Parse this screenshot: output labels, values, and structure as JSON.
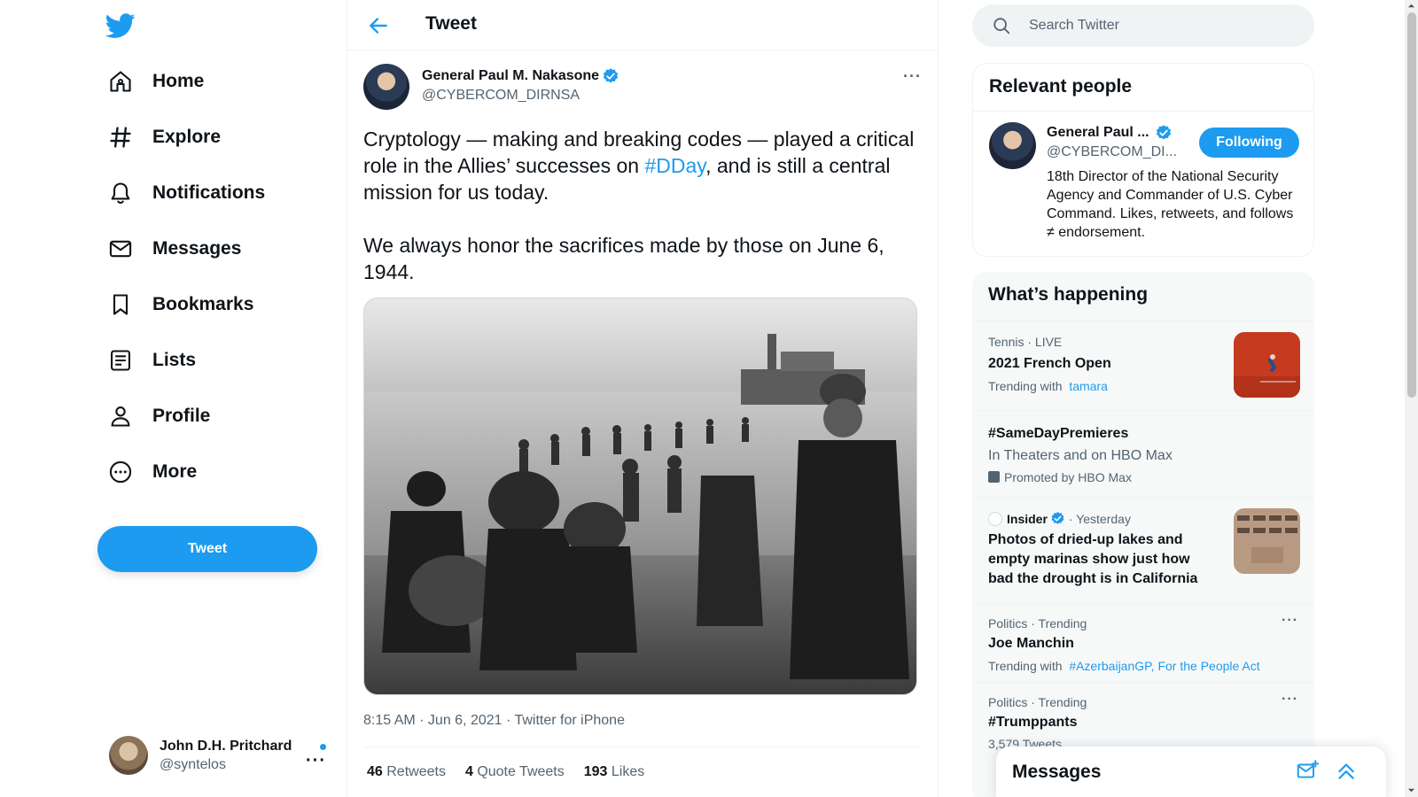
{
  "nav": {
    "items": [
      {
        "label": "Home",
        "icon": "home-icon"
      },
      {
        "label": "Explore",
        "icon": "hashtag-icon"
      },
      {
        "label": "Notifications",
        "icon": "bell-icon"
      },
      {
        "label": "Messages",
        "icon": "envelope-icon"
      },
      {
        "label": "Bookmarks",
        "icon": "bookmark-icon"
      },
      {
        "label": "Lists",
        "icon": "list-icon"
      },
      {
        "label": "Profile",
        "icon": "person-icon"
      },
      {
        "label": "More",
        "icon": "more-circle-icon"
      }
    ],
    "tweet_button": "Tweet",
    "account": {
      "name": "John D.H. Pritchard",
      "handle": "@syntelos",
      "more": "···"
    }
  },
  "main": {
    "header_title": "Tweet",
    "tweet": {
      "author_name": "General Paul M. Nakasone",
      "author_handle": "@CYBERCOM_DIRNSA",
      "more": "···",
      "text_part1": "Cryptology — making and breaking codes — played a critical role in the Allies’ successes on ",
      "hashtag": "#DDay",
      "text_part2": ", and is still a central mission for us today.",
      "text_para2": "We always honor the sacrifices made by those on June 6, 1944.",
      "meta": "8:15 AM · Jun 6, 2021 · Twitter for iPhone",
      "stats": {
        "retweets_count": "46",
        "retweets_label": "Retweets",
        "quotes_count": "4",
        "quotes_label": "Quote Tweets",
        "likes_count": "193",
        "likes_label": "Likes"
      }
    }
  },
  "right": {
    "search_placeholder": "Search Twitter",
    "relevant": {
      "title": "Relevant people",
      "name": "General Paul ...",
      "handle": "@CYBERCOM_DI...",
      "follow_label": "Following",
      "bio": "18th Director of the National Security Agency and Commander of U.S. Cyber Command. Likes, retweets, and follows ≠ endorsement."
    },
    "happening": {
      "title": "What’s happening",
      "trends": [
        {
          "context": "Tennis · LIVE",
          "title": "2021 French Open",
          "sub_prefix": "Trending with",
          "sub_link": "tamara"
        },
        {
          "title": "#SameDayPremieres",
          "sub": "In Theaters and on HBO Max",
          "promo": "Promoted by HBO Max"
        },
        {
          "source": "Insider",
          "time": "· Yesterday",
          "title": "Photos of dried-up lakes and empty marinas show just how bad the drought is in California"
        },
        {
          "context": "Politics · Trending",
          "title": "Joe Manchin",
          "sub_prefix": "Trending with",
          "sub_link": "#AzerbaijanGP, For the People Act"
        },
        {
          "context": "Politics · Trending",
          "title": "#Trumppants",
          "sub": "3,579 Tweets"
        }
      ],
      "more": "···"
    }
  },
  "drawer": {
    "title": "Messages"
  },
  "colors": {
    "accent": "#1d9bf0",
    "text": "#0f1419",
    "muted": "#536471"
  }
}
